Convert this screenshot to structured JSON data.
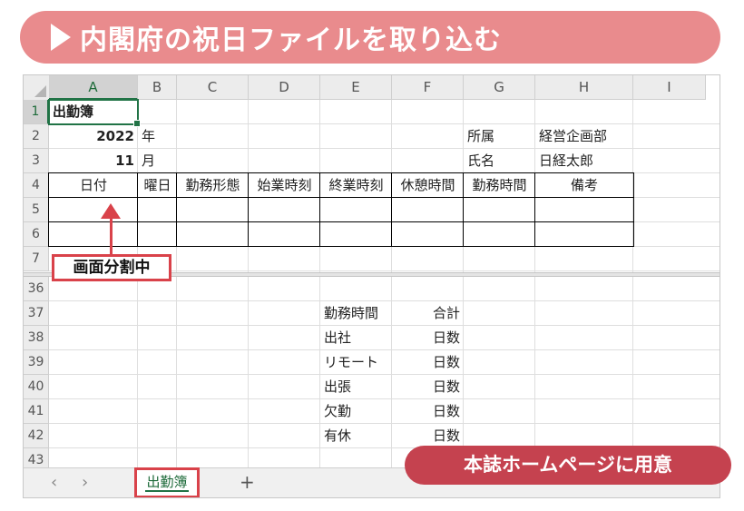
{
  "banner": {
    "title": "内閣府の祝日ファイルを取り込む"
  },
  "sheet": {
    "columns": [
      "A",
      "B",
      "C",
      "D",
      "E",
      "F",
      "G",
      "H",
      "I"
    ],
    "rows_top": [
      "1",
      "2",
      "3",
      "4",
      "5",
      "6",
      "7"
    ],
    "rows_bottom": [
      "36",
      "37",
      "38",
      "39",
      "40",
      "41",
      "42",
      "43"
    ],
    "cells": {
      "a1": "出勤簿",
      "a2": "2022",
      "b2": "年",
      "a3": "11",
      "b3": "月",
      "g2": "所属",
      "h2": "経営企画部",
      "g3": "氏名",
      "h3": "日経太郎",
      "headers": [
        "日付",
        "曜日",
        "勤務形態",
        "始業時刻",
        "終業時刻",
        "休憩時間",
        "勤務時間",
        "備考"
      ],
      "summary": [
        {
          "label": "勤務時間",
          "unit": "合計"
        },
        {
          "label": "出社",
          "unit": "日数"
        },
        {
          "label": "リモート",
          "unit": "日数"
        },
        {
          "label": "出張",
          "unit": "日数"
        },
        {
          "label": "欠勤",
          "unit": "日数"
        },
        {
          "label": "有休",
          "unit": "日数"
        }
      ]
    }
  },
  "callout": {
    "label": "画面分割中"
  },
  "tabs": {
    "prev": "‹",
    "next": "›",
    "active": "出勤簿",
    "add": "+"
  },
  "badge": {
    "label": "本誌ホームページに用意"
  }
}
